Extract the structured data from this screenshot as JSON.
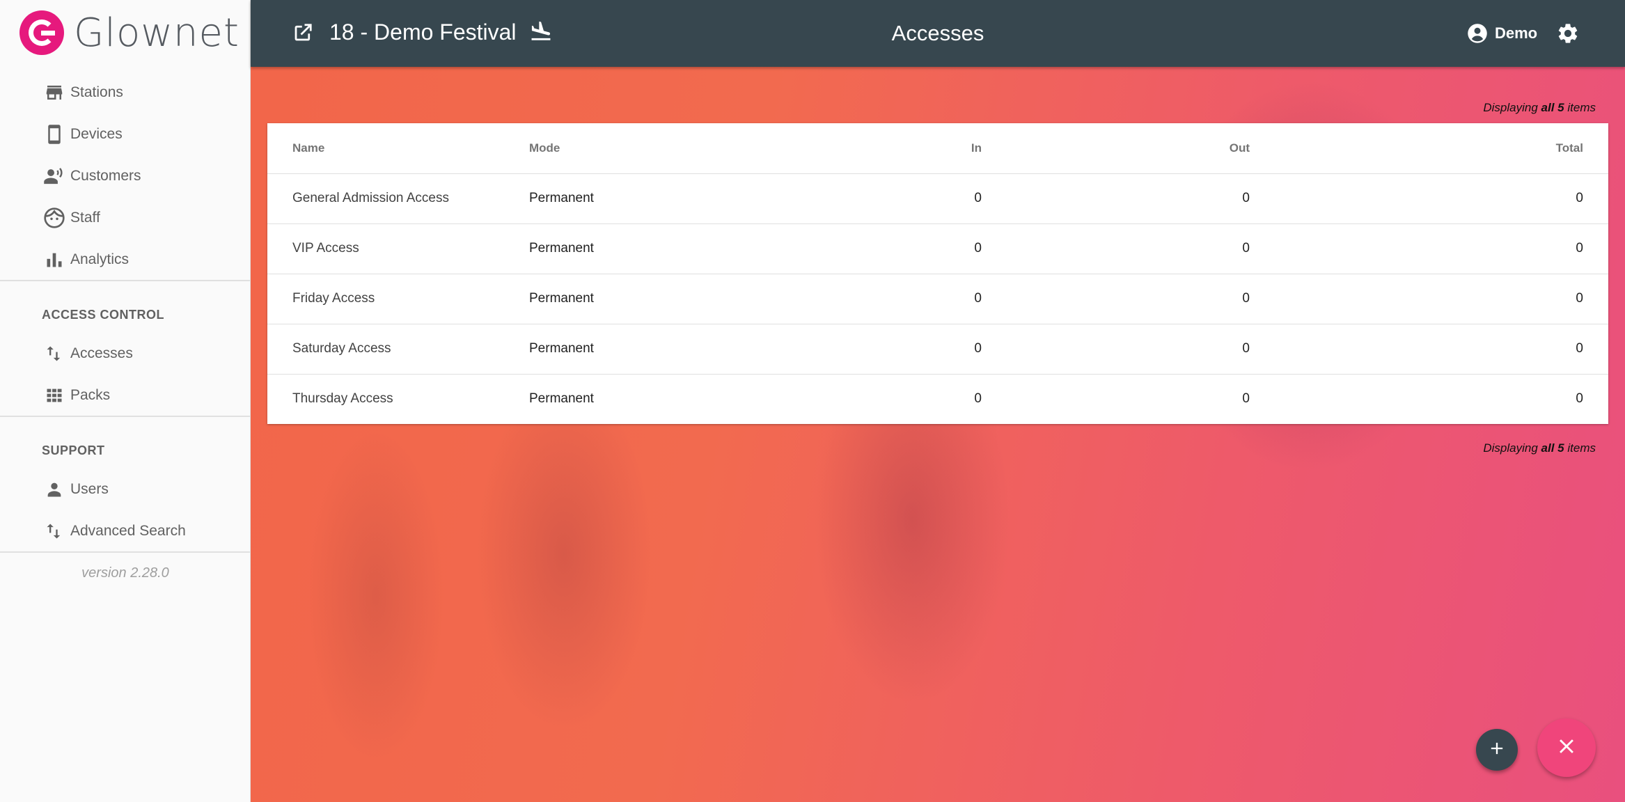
{
  "app": {
    "logo_text": "Glownet",
    "brand_color": "#e6197d",
    "header_color": "#37474f"
  },
  "sidebar": {
    "items": [
      {
        "label": "Stations",
        "icon": "store-icon"
      },
      {
        "label": "Devices",
        "icon": "phone-icon"
      },
      {
        "label": "Customers",
        "icon": "customers-icon"
      },
      {
        "label": "Staff",
        "icon": "face-icon"
      },
      {
        "label": "Analytics",
        "icon": "bar-chart-icon"
      }
    ],
    "access_control": {
      "title": "ACCESS CONTROL",
      "items": [
        {
          "label": "Accesses",
          "icon": "swap-vertical-icon"
        },
        {
          "label": "Packs",
          "icon": "grid-icon"
        }
      ]
    },
    "support": {
      "title": "SUPPORT",
      "items": [
        {
          "label": "Users",
          "icon": "person-icon"
        },
        {
          "label": "Advanced Search",
          "icon": "swap-vertical-icon"
        }
      ]
    },
    "version": "version 2.28.0"
  },
  "topbar": {
    "event_title": "18 - Demo Festival",
    "page_title": "Accesses",
    "user_name": "Demo"
  },
  "main": {
    "count_prefix": "Displaying",
    "count_strong": "all 5",
    "count_suffix": "items",
    "table": {
      "headers": {
        "name": "Name",
        "mode": "Mode",
        "in": "In",
        "out": "Out",
        "total": "Total"
      },
      "rows": [
        {
          "name": "General Admission Access",
          "mode": "Permanent",
          "in": "0",
          "out": "0",
          "total": "0"
        },
        {
          "name": "VIP Access",
          "mode": "Permanent",
          "in": "0",
          "out": "0",
          "total": "0"
        },
        {
          "name": "Friday Access",
          "mode": "Permanent",
          "in": "0",
          "out": "0",
          "total": "0"
        },
        {
          "name": "Saturday Access",
          "mode": "Permanent",
          "in": "0",
          "out": "0",
          "total": "0"
        },
        {
          "name": "Thursday Access",
          "mode": "Permanent",
          "in": "0",
          "out": "0",
          "total": "0"
        }
      ]
    }
  },
  "fabs": {
    "add_icon": "plus-icon",
    "close_icon": "close-icon",
    "close_color": "#f0457b"
  }
}
